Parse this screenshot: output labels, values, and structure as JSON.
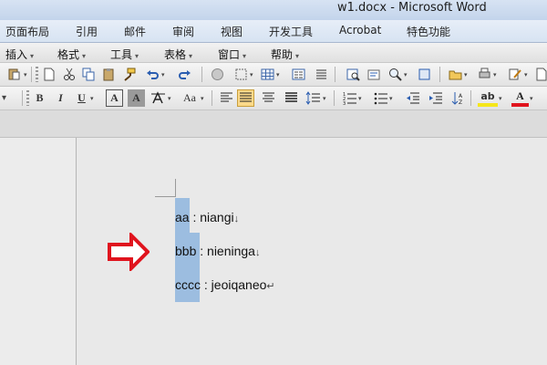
{
  "window": {
    "title": "w1.docx - Microsoft Word"
  },
  "ribbon_tabs": [
    "页面布局",
    "引用",
    "邮件",
    "审阅",
    "视图",
    "开发工具",
    "Acrobat",
    "特色功能"
  ],
  "menus": [
    "插入",
    "格式",
    "工具",
    "表格",
    "窗口",
    "帮助"
  ],
  "toolbar_glyphs": {
    "bold": "B",
    "italic": "I",
    "underline": "U",
    "font_color_a": "A",
    "shade_a": "A",
    "case": "Aa",
    "font_color": "A",
    "highlight": "ab"
  },
  "document": {
    "lines": [
      {
        "key": "aa",
        "sep": " : ",
        "value": "niangi",
        "mark": "↓"
      },
      {
        "key": "bbb",
        "sep": " : ",
        "value": "nieninga",
        "mark": "↓"
      },
      {
        "key": "cccc",
        "sep": " : ",
        "value": "jeoiqaneo",
        "mark": "↵"
      }
    ]
  },
  "colors": {
    "selection": "#9cbde0",
    "arrow": "#e0141e",
    "page": "#e9e9e9",
    "highlight_button": "#fbd98a"
  }
}
